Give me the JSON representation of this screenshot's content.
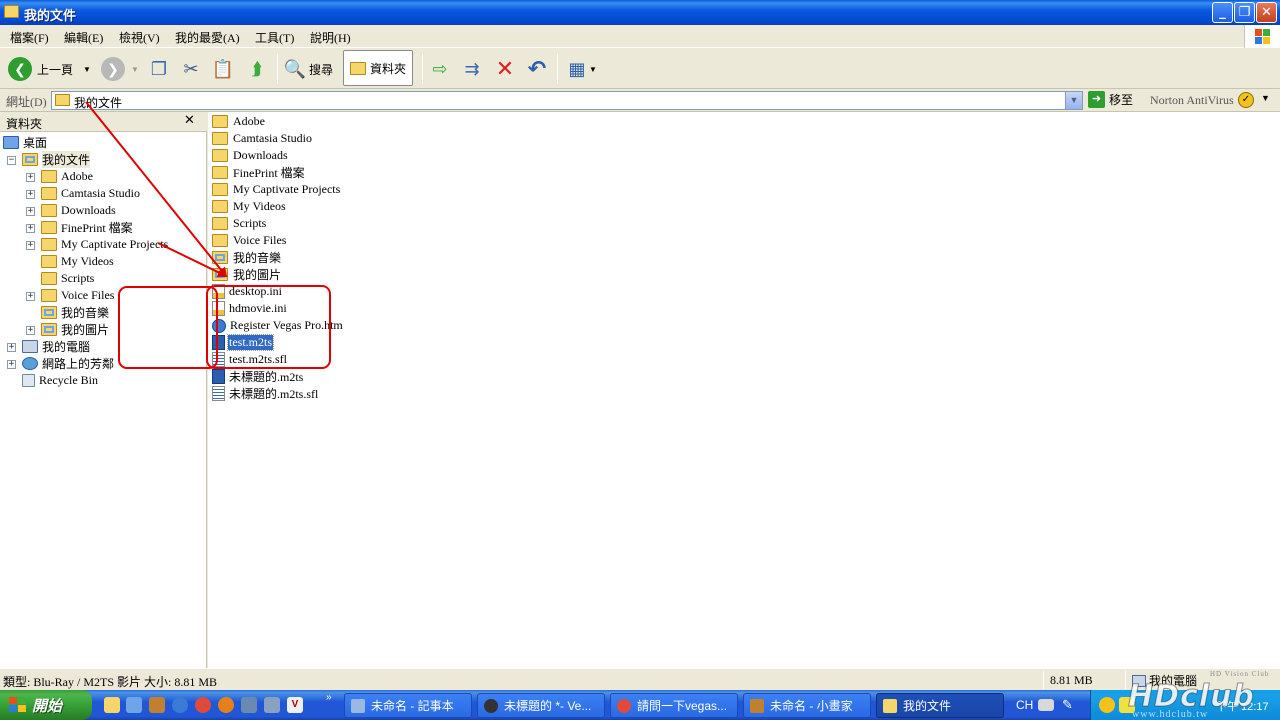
{
  "window": {
    "title": "我的文件",
    "buttons": {
      "minimize": "_",
      "maximize": "❐",
      "close": "✕"
    }
  },
  "menu": [
    "檔案(F)",
    "編輯(E)",
    "檢視(V)",
    "我的最愛(A)",
    "工具(T)",
    "說明(H)"
  ],
  "toolbar": {
    "back_label": "上一頁",
    "search_label": "搜尋",
    "folders_label": "資料夾"
  },
  "address": {
    "label": "網址(D)",
    "value": "我的文件",
    "go_label": "移至",
    "norton_label": "Norton AntiVirus"
  },
  "folders_pane": {
    "title": "資料夾",
    "close": "✕",
    "tree": [
      {
        "label": "桌面",
        "icon": "desktop-icon"
      },
      {
        "label": "我的文件",
        "icon": "documents-folder-icon"
      },
      {
        "label": "Adobe",
        "icon": "folder-icon"
      },
      {
        "label": "Camtasia Studio",
        "icon": "folder-icon"
      },
      {
        "label": "Downloads",
        "icon": "folder-icon"
      },
      {
        "label": "FinePrint 檔案",
        "icon": "folder-icon"
      },
      {
        "label": "My Captivate Projects",
        "icon": "folder-icon"
      },
      {
        "label": "My Videos",
        "icon": "folder-icon"
      },
      {
        "label": "Scripts",
        "icon": "folder-icon"
      },
      {
        "label": "Voice Files",
        "icon": "folder-icon"
      },
      {
        "label": "我的音樂",
        "icon": "music-folder-icon"
      },
      {
        "label": "我的圖片",
        "icon": "pictures-folder-icon"
      },
      {
        "label": "我的電腦",
        "icon": "computer-icon"
      },
      {
        "label": "網路上的芳鄰",
        "icon": "network-icon"
      },
      {
        "label": "Recycle Bin",
        "icon": "recycle-bin-icon"
      }
    ]
  },
  "files": [
    {
      "name": "Adobe",
      "type": "folder"
    },
    {
      "name": "Camtasia Studio",
      "type": "folder"
    },
    {
      "name": "Downloads",
      "type": "folder"
    },
    {
      "name": "FinePrint 檔案",
      "type": "folder"
    },
    {
      "name": "My Captivate Projects",
      "type": "folder"
    },
    {
      "name": "My Videos",
      "type": "folder"
    },
    {
      "name": "Scripts",
      "type": "folder"
    },
    {
      "name": "Voice Files",
      "type": "folder"
    },
    {
      "name": "我的音樂",
      "type": "folder"
    },
    {
      "name": "我的圖片",
      "type": "folder"
    },
    {
      "name": "desktop.ini",
      "type": "ini"
    },
    {
      "name": "hdmovie.ini",
      "type": "ini"
    },
    {
      "name": "Register Vegas Pro.htm",
      "type": "htm"
    },
    {
      "name": "test.m2ts",
      "type": "video",
      "selected": true
    },
    {
      "name": "test.m2ts.sfl",
      "type": "sfl"
    },
    {
      "name": "未標題的.m2ts",
      "type": "video"
    },
    {
      "name": "未標題的.m2ts.sfl",
      "type": "sfl"
    }
  ],
  "status": {
    "left": "類型: Blu-Ray / M2TS 影片 大小: 8.81 MB",
    "size": "8.81 MB",
    "location": "我的電腦"
  },
  "taskbar": {
    "start_label": "開始",
    "quicklaunch_more": "»",
    "tasks": [
      {
        "label": "未命名 - 記事本",
        "active": false
      },
      {
        "label": "未標題的 *- Ve...",
        "active": false
      },
      {
        "label": "請問一下vegas...",
        "active": false
      },
      {
        "label": "未命名 - 小畫家",
        "active": false
      },
      {
        "label": "我的文件",
        "active": true
      }
    ],
    "lang": "CH",
    "clock": "下午 12:17"
  },
  "watermark": {
    "text": "HDclub",
    "tag": "HD Vision Club",
    "url": "www.hdclub.tw"
  },
  "colors": {
    "titlebar": "#0047d1",
    "selection": "#316ac5",
    "annotation": "#e00000",
    "taskbar": "#2157d7",
    "start": "#329a32"
  }
}
